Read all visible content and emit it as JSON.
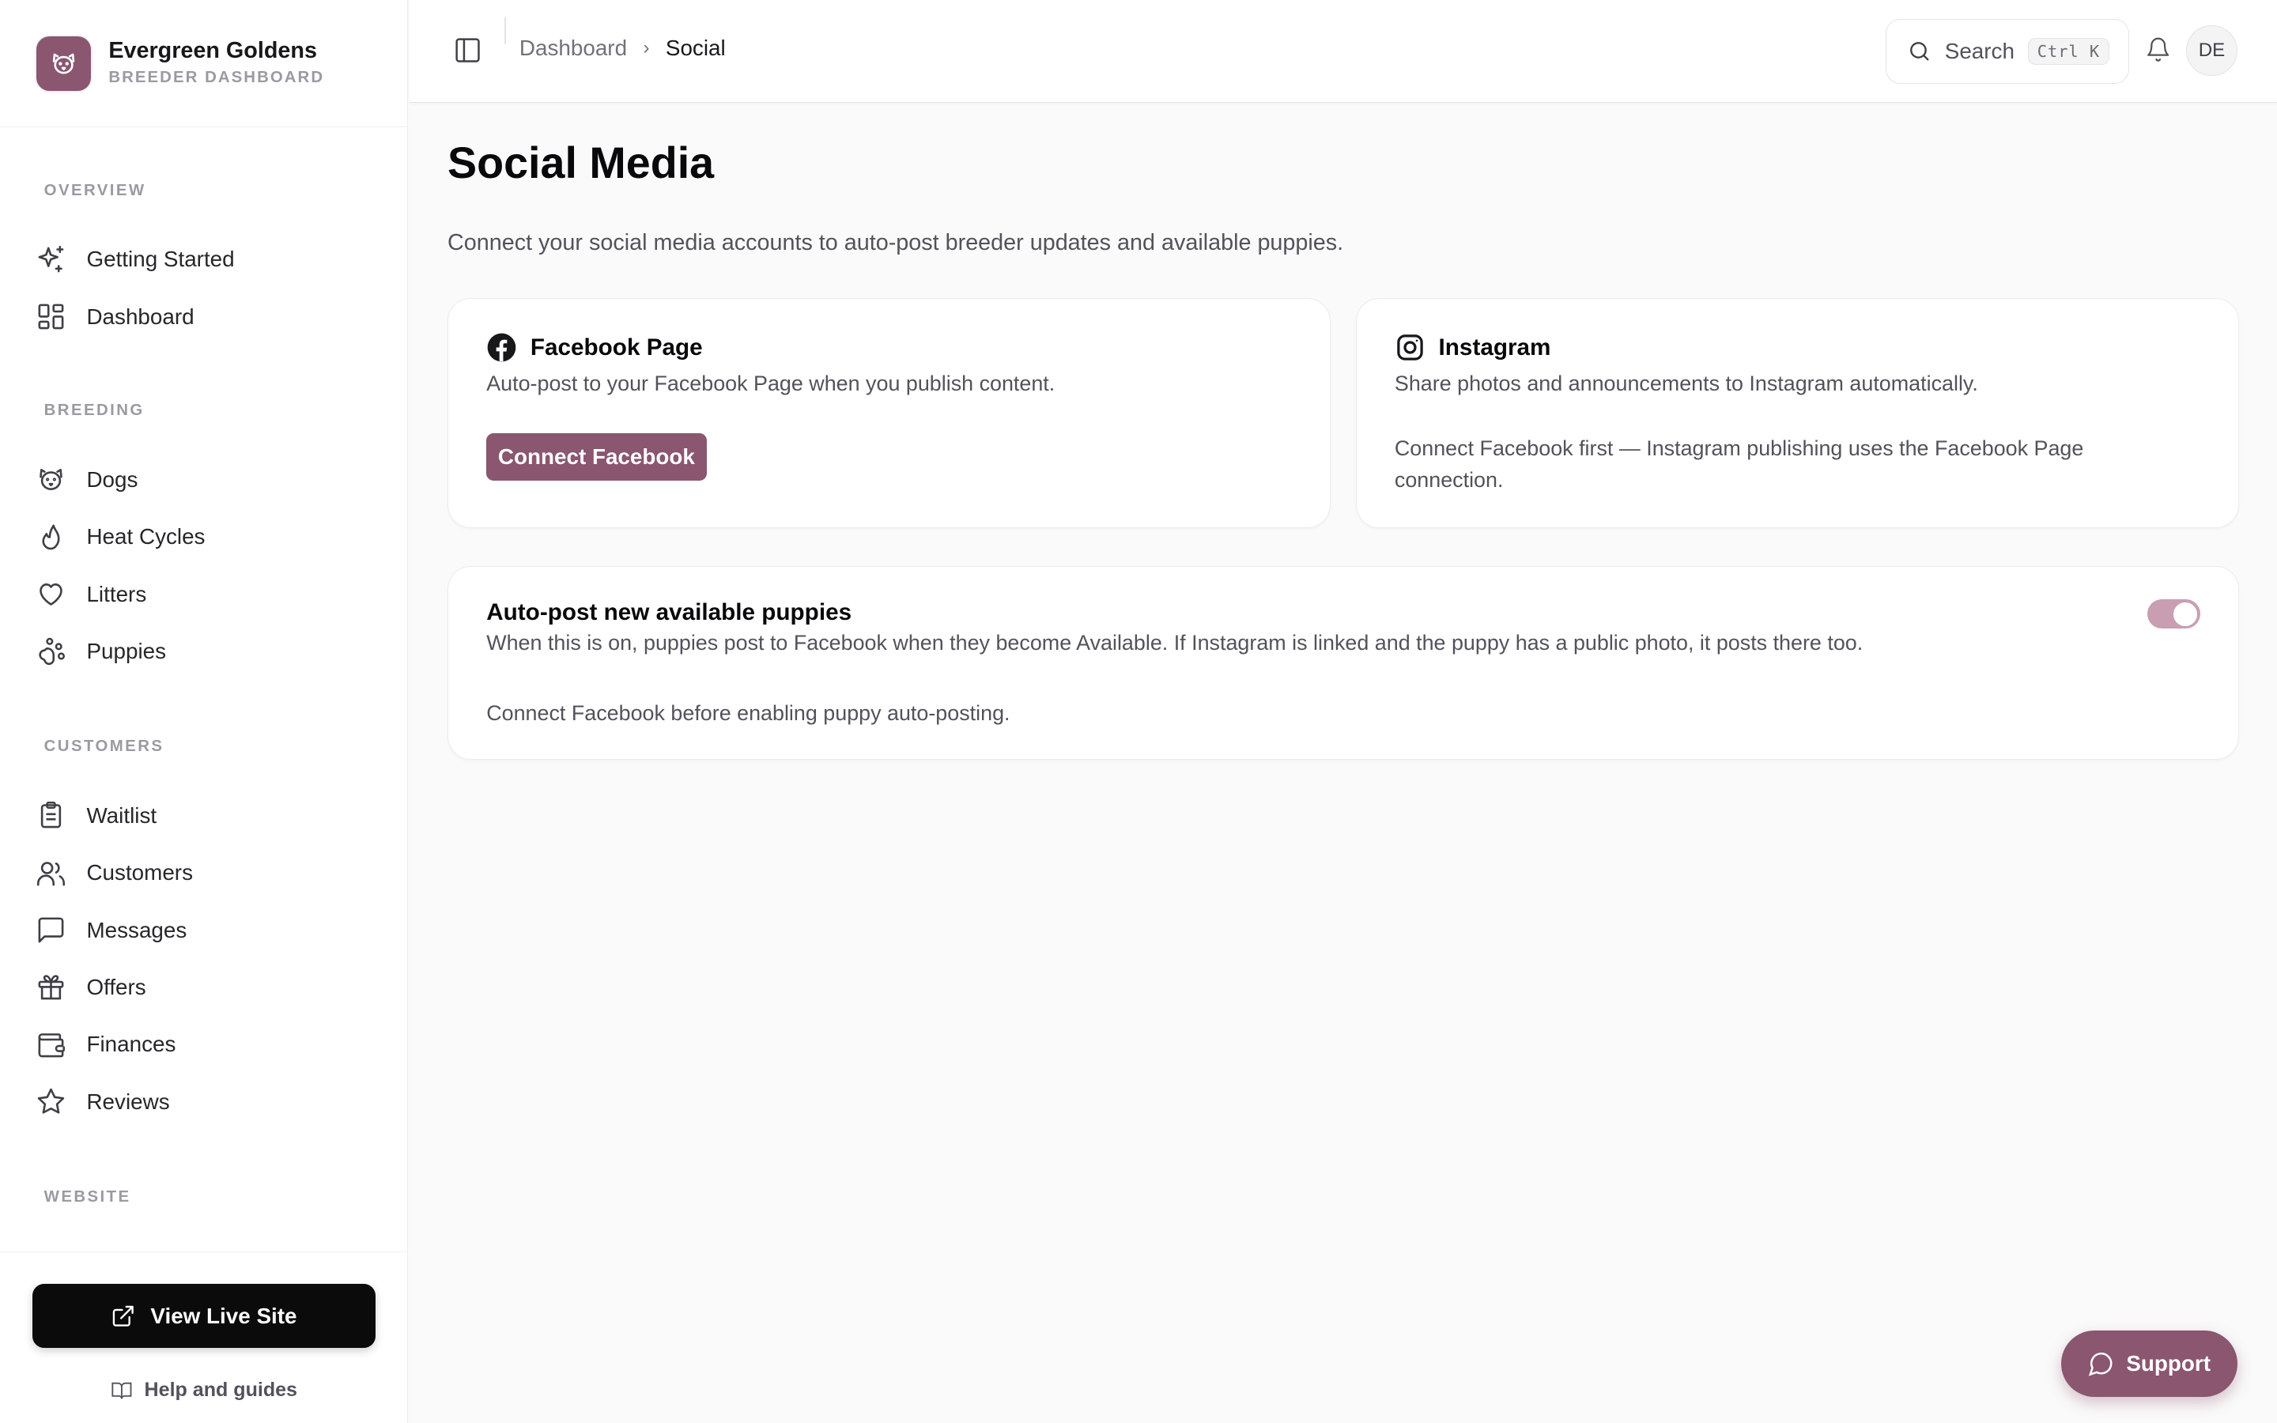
{
  "brand": {
    "name": "Evergreen Goldens",
    "subtitle": "BREEDER DASHBOARD",
    "logo_icon": "dog-face-icon",
    "accent_color": "#8a5670"
  },
  "sidebar": {
    "sections": [
      {
        "title": "OVERVIEW"
      },
      {
        "title": "BREEDING"
      },
      {
        "title": "CUSTOMERS"
      },
      {
        "title": "WEBSITE"
      }
    ],
    "items": [
      {
        "label": "Getting Started",
        "icon": "sparkles-icon"
      },
      {
        "label": "Dashboard",
        "icon": "layout-grid-icon"
      },
      {
        "label": "Dogs",
        "icon": "dog-icon"
      },
      {
        "label": "Heat Cycles",
        "icon": "flame-icon"
      },
      {
        "label": "Litters",
        "icon": "heart-icon"
      },
      {
        "label": "Puppies",
        "icon": "paw-print-icon"
      },
      {
        "label": "Waitlist",
        "icon": "clipboard-list-icon"
      },
      {
        "label": "Customers",
        "icon": "users-icon"
      },
      {
        "label": "Messages",
        "icon": "message-square-icon"
      },
      {
        "label": "Offers",
        "icon": "gift-icon"
      },
      {
        "label": "Finances",
        "icon": "wallet-icon"
      },
      {
        "label": "Reviews",
        "icon": "star-icon"
      }
    ],
    "view_live_site": "View Live Site",
    "help_link": "Help and guides"
  },
  "topbar": {
    "breadcrumb": [
      "Dashboard",
      "Social"
    ],
    "search_label": "Search",
    "search_shortcut": "Ctrl K",
    "avatar_initials": "DE"
  },
  "page": {
    "title": "Social Media",
    "description": "Connect your social media accounts to auto-post breeder updates and available puppies."
  },
  "cards": {
    "facebook": {
      "title": "Facebook Page",
      "description": "Auto-post to your Facebook Page when you publish content.",
      "button": "Connect Facebook",
      "icon": "facebook-icon"
    },
    "instagram": {
      "title": "Instagram",
      "description": "Share photos and announcements to Instagram automatically.",
      "note": "Connect Facebook first — Instagram publishing uses the Facebook Page connection.",
      "icon": "instagram-icon"
    },
    "autopost": {
      "title": "Auto-post new available puppies",
      "description": "When this is on, puppies post to Facebook when they become Available. If Instagram is linked and the puppy has a public photo, it posts there too.",
      "note": "Connect Facebook before enabling puppy auto-posting.",
      "toggle_on": true,
      "toggle_color": "#c99eb3"
    }
  },
  "support_button": "Support"
}
